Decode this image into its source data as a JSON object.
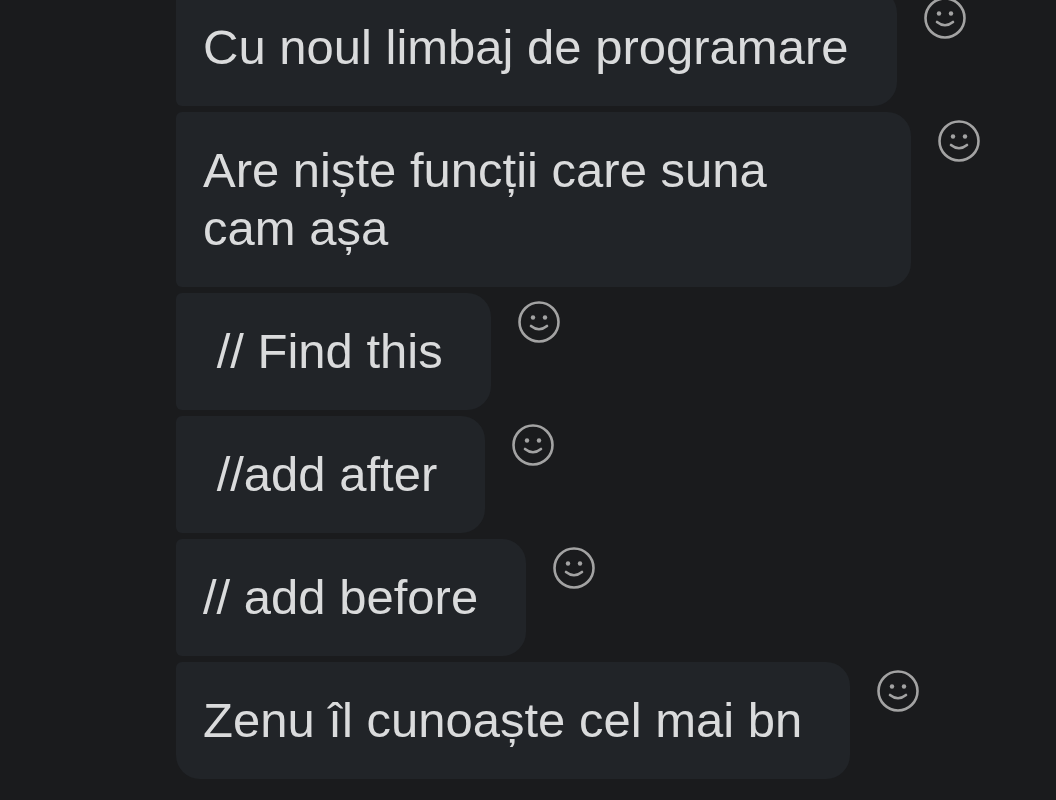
{
  "conversation": {
    "messages": [
      {
        "text": "Cu noul limbaj de programare"
      },
      {
        "text": "Are niște funcții care suna cam așa"
      },
      {
        "text": " // Find this"
      },
      {
        "text": " //add after"
      },
      {
        "text": "// add before"
      },
      {
        "text": "Zenu îl cunoaște cel mai bn"
      }
    ]
  }
}
